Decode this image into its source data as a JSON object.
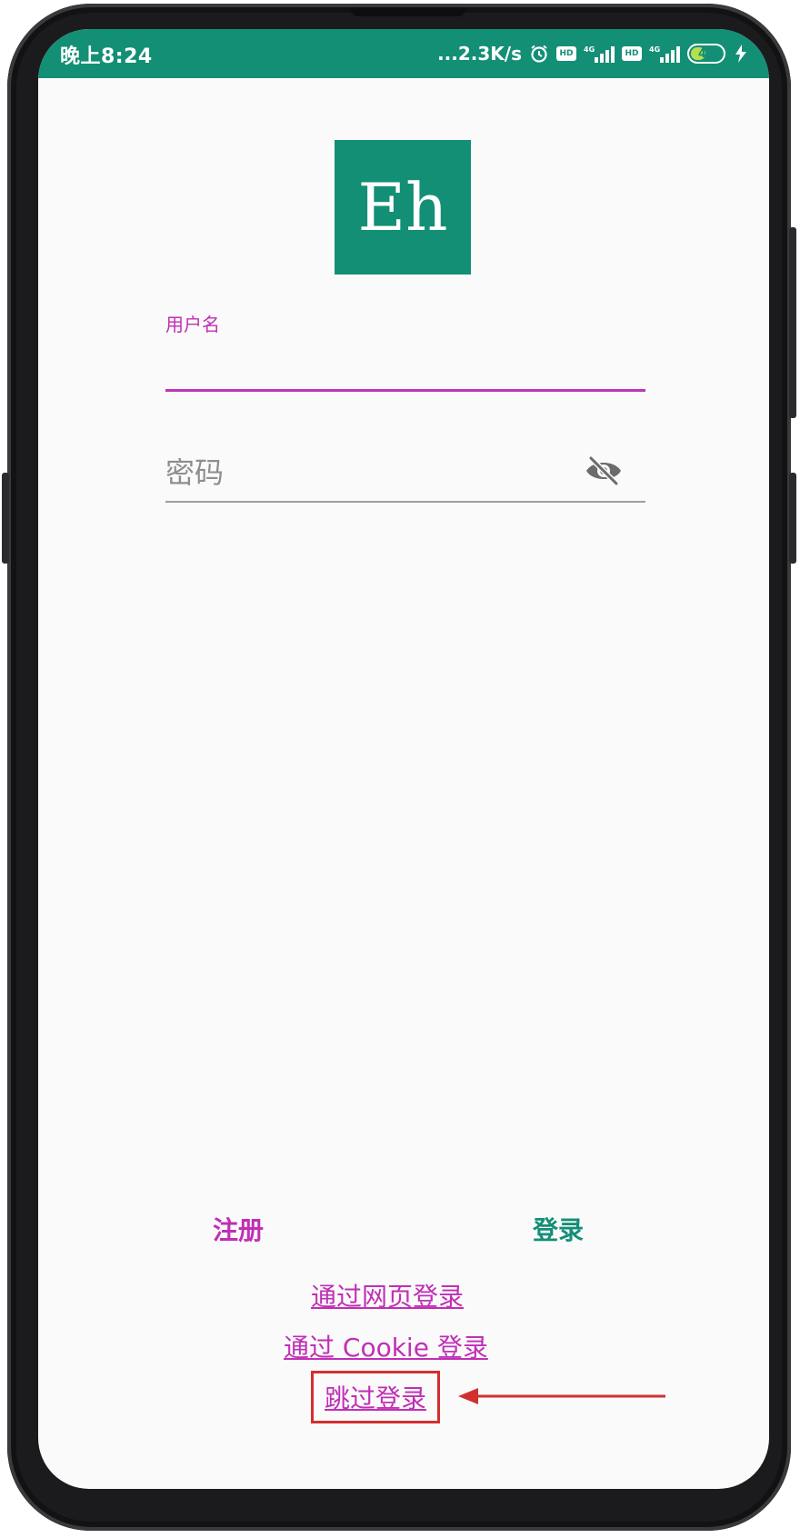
{
  "status_bar": {
    "time": "晚上8:24",
    "speed": "...2.3K/s",
    "battery": "48",
    "icons": [
      "alarm-icon",
      "hd-icon",
      "signal-4g-icon",
      "hd-icon",
      "signal-4g-icon",
      "battery-icon",
      "charging-icon"
    ],
    "hd_label": "HD",
    "net_label": "4G",
    "battery_level": 0.48,
    "accent_color": "#138f76"
  },
  "logo": {
    "text": "Eh"
  },
  "username": {
    "label": "用户名",
    "value": ""
  },
  "password": {
    "placeholder": "密码",
    "value": "",
    "toggle_icon": "eye-off-icon"
  },
  "actions": {
    "register": "注册",
    "login": "登录"
  },
  "links": {
    "web_login": "通过网页登录",
    "cookie_login": "通过 Cookie 登录",
    "skip_login": "跳过登录"
  },
  "colors": {
    "brand": "#138f76",
    "accent": "#c02fb5",
    "annotation": "#d32f2f"
  }
}
